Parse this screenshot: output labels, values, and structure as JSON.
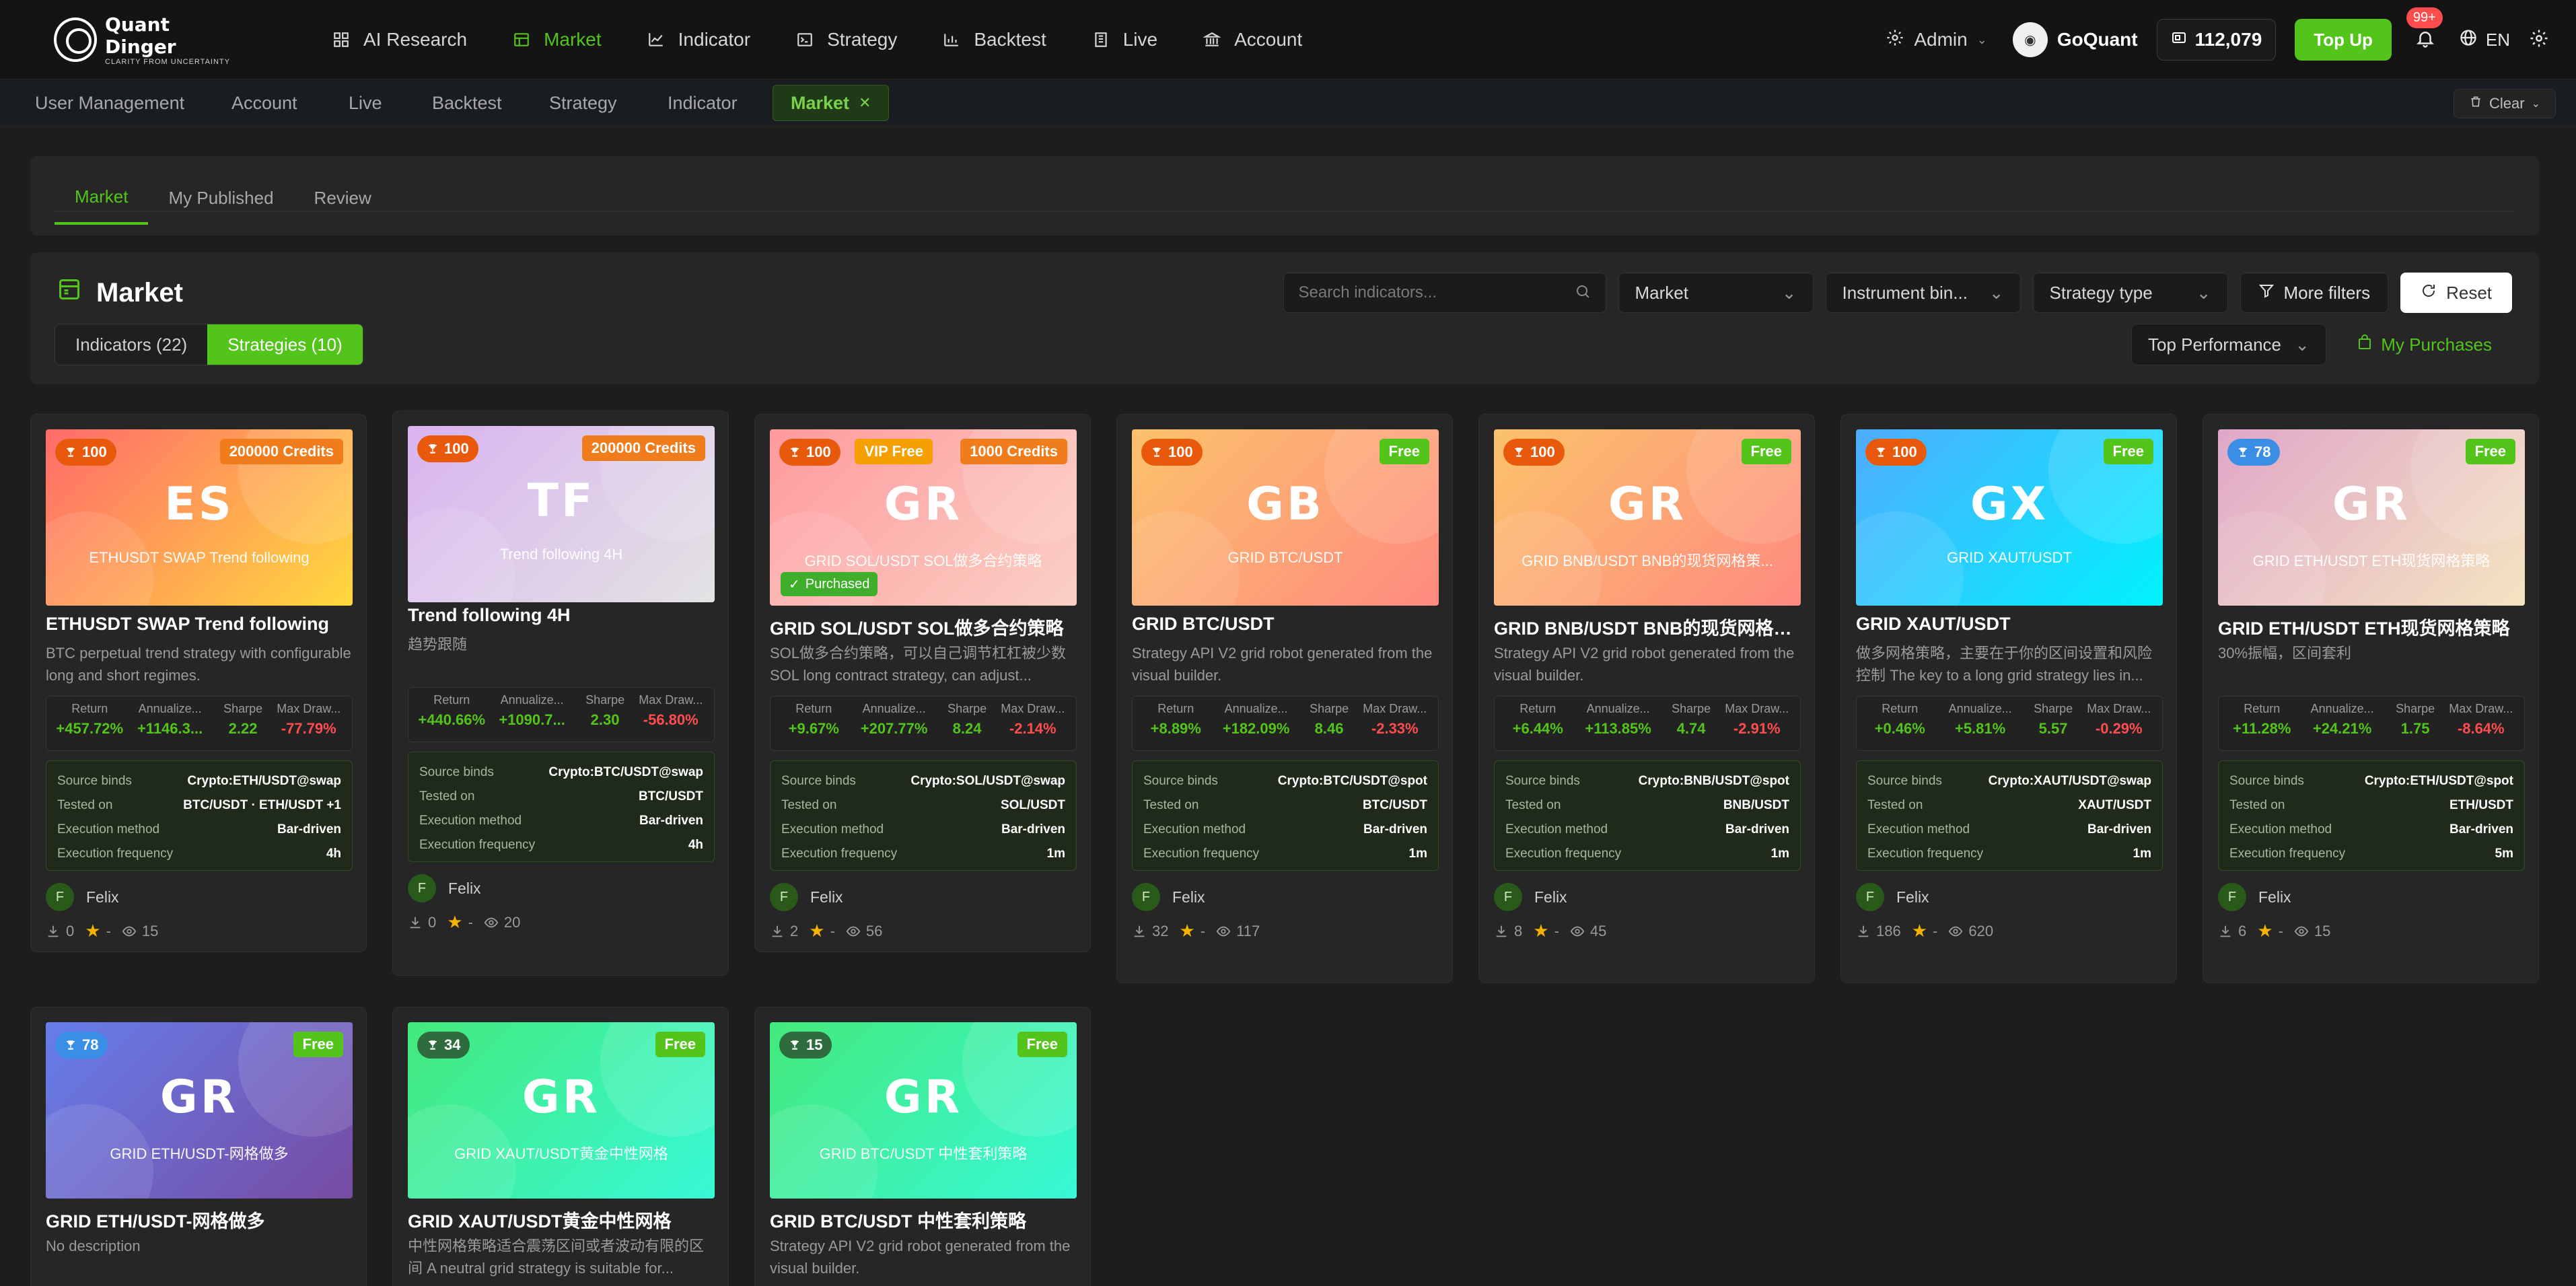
{
  "brand": {
    "title": "Quant Dinger",
    "tagline": "CLARITY FROM UNCERTAINTY"
  },
  "nav": [
    {
      "label": "AI Research",
      "icon": "grid-icon",
      "active": false
    },
    {
      "label": "Market",
      "icon": "table-icon",
      "active": true
    },
    {
      "label": "Indicator",
      "icon": "line-chart-icon",
      "active": false
    },
    {
      "label": "Strategy",
      "icon": "terminal-icon",
      "active": false
    },
    {
      "label": "Backtest",
      "icon": "bar-chart-icon",
      "active": false
    },
    {
      "label": "Live",
      "icon": "building-icon",
      "active": false
    },
    {
      "label": "Account",
      "icon": "bank-icon",
      "active": false
    }
  ],
  "header": {
    "admin_label": "Admin",
    "username": "GoQuant",
    "credits": "112,079",
    "topup_label": "Top Up",
    "notification_badge": "99+",
    "language": "EN"
  },
  "tabs": [
    {
      "label": "User Management",
      "active": false
    },
    {
      "label": "Account",
      "active": false
    },
    {
      "label": "Live",
      "active": false
    },
    {
      "label": "Backtest",
      "active": false
    },
    {
      "label": "Strategy",
      "active": false
    },
    {
      "label": "Indicator",
      "active": false
    },
    {
      "label": "Market",
      "active": true
    }
  ],
  "clear_label": "Clear",
  "subtabs": [
    {
      "label": "Market",
      "active": true
    },
    {
      "label": "My Published",
      "active": false
    },
    {
      "label": "Review",
      "active": false
    }
  ],
  "market": {
    "title": "Market",
    "search_placeholder": "Search indicators...",
    "filter_market": "Market",
    "filter_instrument": "Instrument bin...",
    "filter_strategy_type": "Strategy type",
    "more_filters": "More filters",
    "reset": "Reset",
    "toggle_indicators": "Indicators (22)",
    "toggle_strategies": "Strategies (10)",
    "sort": "Top Performance",
    "my_purchases": "My Purchases"
  },
  "labels": {
    "return": "Return",
    "annualized": "Annualize...",
    "sharpe": "Sharpe",
    "maxdd": "Max Draw...",
    "source_binds": "Source binds",
    "tested_on": "Tested on",
    "execution_method": "Execution method",
    "execution_frequency": "Execution frequency"
  },
  "cards": [
    {
      "initials": "ES",
      "banner_subtitle": "ETHUSDT SWAP Trend following",
      "gradient": [
        "#ff6b6b",
        "#ffd93d"
      ],
      "score": "100",
      "score_color": "#e8590c",
      "pills": [
        {
          "text": "200000 Credits",
          "color": "#f07c1c"
        }
      ],
      "purchased": false,
      "title": "ETHUSDT SWAP Trend following",
      "desc": "BTC perpetual trend strategy with configurable long and short regimes.",
      "ret": "+457.72%",
      "ann": "+1146.3...",
      "sharpe": "2.22",
      "mdd": "-77.79%",
      "source": "Crypto:ETH/USDT@swap",
      "tested": "BTC/USDT · ETH/USDT +1",
      "method": "Bar-driven",
      "freq": "4h",
      "author": "Felix",
      "author_initial": "F",
      "downloads": "0",
      "rating": "-",
      "views": "15"
    },
    {
      "initials": "TF",
      "banner_subtitle": "Trend following 4H",
      "gradient": [
        "#d9b3f0",
        "#e3e3e3"
      ],
      "score": "100",
      "score_color": "#e8590c",
      "pills": [
        {
          "text": "200000 Credits",
          "color": "#f07c1c"
        }
      ],
      "purchased": false,
      "title": "Trend following 4H",
      "desc": "趋势跟随",
      "ret": "+440.66%",
      "ann": "+1090.7...",
      "sharpe": "2.30",
      "mdd": "-56.80%",
      "source": "Crypto:BTC/USDT@swap",
      "tested": "BTC/USDT",
      "method": "Bar-driven",
      "freq": "4h",
      "author": "Felix",
      "author_initial": "F",
      "downloads": "0",
      "rating": "-",
      "views": "20"
    },
    {
      "initials": "GR",
      "banner_subtitle": "GRID SOL/USDT SOL做多合约策略",
      "gradient": [
        "#ff9a9e",
        "#fad0c4"
      ],
      "score": "100",
      "score_color": "#e8590c",
      "pills": [
        {
          "text": "VIP Free",
          "color": "#f59f00"
        },
        {
          "text": "1000 Credits",
          "color": "#f07c1c"
        }
      ],
      "purchased": true,
      "purchased_label": "Purchased",
      "title": "GRID SOL/USDT SOL做多合约策略",
      "desc": "SOL做多合约策略，可以自己调节杠杠被少数 SOL long contract strategy, can adjust...",
      "ret": "+9.67%",
      "ann": "+207.77%",
      "sharpe": "8.24",
      "mdd": "-2.14%",
      "source": "Crypto:SOL/USDT@swap",
      "tested": "SOL/USDT",
      "method": "Bar-driven",
      "freq": "1m",
      "author": "Felix",
      "author_initial": "F",
      "downloads": "2",
      "rating": "-",
      "views": "56"
    },
    {
      "initials": "GB",
      "banner_subtitle": "GRID BTC/USDT",
      "gradient": [
        "#fbc26b",
        "#ff8a80"
      ],
      "score": "100",
      "score_color": "#e8590c",
      "pills": [
        {
          "text": "Free",
          "color": "#52c41a"
        }
      ],
      "purchased": false,
      "title": "GRID BTC/USDT",
      "desc": "Strategy API V2 grid robot generated from the visual builder.",
      "ret": "+8.89%",
      "ann": "+182.09%",
      "sharpe": "8.46",
      "mdd": "-2.33%",
      "source": "Crypto:BTC/USDT@spot",
      "tested": "BTC/USDT",
      "method": "Bar-driven",
      "freq": "1m",
      "author": "Felix",
      "author_initial": "F",
      "downloads": "32",
      "rating": "-",
      "views": "117"
    },
    {
      "initials": "GR",
      "banner_subtitle": "GRID BNB/USDT BNB的现货网格策...",
      "gradient": [
        "#fbc26b",
        "#ff8a80"
      ],
      "score": "100",
      "score_color": "#e8590c",
      "pills": [
        {
          "text": "Free",
          "color": "#52c41a"
        }
      ],
      "purchased": false,
      "title": "GRID BNB/USDT BNB的现货网格策略",
      "desc": "Strategy API V2 grid robot generated from the visual builder.",
      "ret": "+6.44%",
      "ann": "+113.85%",
      "sharpe": "4.74",
      "mdd": "-2.91%",
      "source": "Crypto:BNB/USDT@spot",
      "tested": "BNB/USDT",
      "method": "Bar-driven",
      "freq": "1m",
      "author": "Felix",
      "author_initial": "F",
      "downloads": "8",
      "rating": "-",
      "views": "45"
    },
    {
      "initials": "GX",
      "banner_subtitle": "GRID XAUT/USDT",
      "gradient": [
        "#4facfe",
        "#00f2fe"
      ],
      "score": "100",
      "score_color": "#e8590c",
      "pills": [
        {
          "text": "Free",
          "color": "#52c41a"
        }
      ],
      "purchased": false,
      "title": "GRID XAUT/USDT",
      "desc": "做多网格策略，主要在于你的区间设置和风险控制 The key to a long grid strategy lies in...",
      "ret": "+0.46%",
      "ann": "+5.81%",
      "sharpe": "5.57",
      "mdd": "-0.29%",
      "source": "Crypto:XAUT/USDT@swap",
      "tested": "XAUT/USDT",
      "method": "Bar-driven",
      "freq": "1m",
      "author": "Felix",
      "author_initial": "F",
      "downloads": "186",
      "rating": "-",
      "views": "620"
    },
    {
      "initials": "GR",
      "banner_subtitle": "GRID ETH/USDT ETH现货网格策略",
      "gradient": [
        "#e0a7c8",
        "#f4e4c1"
      ],
      "score": "78",
      "score_color": "#3a8ee6",
      "pills": [
        {
          "text": "Free",
          "color": "#52c41a"
        }
      ],
      "purchased": false,
      "title": "GRID ETH/USDT ETH现货网格策略",
      "desc": "30%振幅，区间套利",
      "ret": "+11.28%",
      "ann": "+24.21%",
      "sharpe": "1.75",
      "mdd": "-8.64%",
      "source": "Crypto:ETH/USDT@spot",
      "tested": "ETH/USDT",
      "method": "Bar-driven",
      "freq": "5m",
      "author": "Felix",
      "author_initial": "F",
      "downloads": "6",
      "rating": "-",
      "views": "15"
    },
    {
      "initials": "GR",
      "banner_subtitle": "GRID ETH/USDT-网格做多",
      "gradient": [
        "#667eea",
        "#764ba2"
      ],
      "score": "78",
      "score_color": "#3a8ee6",
      "pills": [
        {
          "text": "Free",
          "color": "#52c41a"
        }
      ],
      "purchased": false,
      "title": "GRID ETH/USDT-网格做多",
      "desc": "No description"
    },
    {
      "initials": "GR",
      "banner_subtitle": "GRID XAUT/USDT黄金中性网格",
      "gradient": [
        "#43e97b",
        "#38f9d7"
      ],
      "score": "34",
      "score_color": "#2e6b3d",
      "pills": [
        {
          "text": "Free",
          "color": "#52c41a"
        }
      ],
      "purchased": false,
      "title": "GRID XAUT/USDT黄金中性网格",
      "desc": "中性网格策略适合震荡区间或者波动有限的区间 A neutral grid strategy is suitable for..."
    },
    {
      "initials": "GR",
      "banner_subtitle": "GRID BTC/USDT 中性套利策略",
      "gradient": [
        "#43e97b",
        "#38f9d7"
      ],
      "score": "15",
      "score_color": "#2e6b3d",
      "pills": [
        {
          "text": "Free",
          "color": "#52c41a"
        }
      ],
      "purchased": false,
      "title": "GRID BTC/USDT 中性套利策略",
      "desc": "Strategy API V2 grid robot generated from the visual builder."
    }
  ]
}
